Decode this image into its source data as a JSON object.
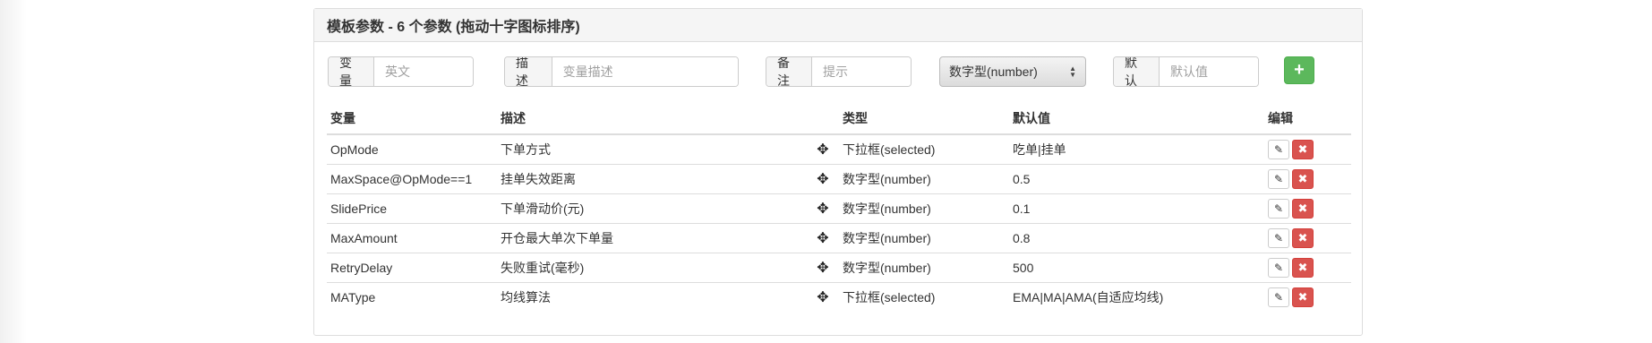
{
  "panel": {
    "title": "模板参数 - 6 个参数 (拖动十字图标排序)"
  },
  "form": {
    "variable": {
      "label": "变量",
      "placeholder": "英文"
    },
    "description": {
      "label": "描述",
      "placeholder": "变量描述"
    },
    "note": {
      "label": "备注",
      "placeholder": "提示"
    },
    "type_select": {
      "value": "数字型(number)"
    },
    "default": {
      "label": "默认",
      "placeholder": "默认值"
    },
    "add_icon": "plus-icon"
  },
  "table": {
    "headers": [
      "变量",
      "描述",
      "类型",
      "默认值",
      "编辑"
    ],
    "rows": [
      {
        "variable": "OpMode",
        "description": "下单方式",
        "type": "下拉框(selected)",
        "default": "吃单|挂单"
      },
      {
        "variable": "MaxSpace@OpMode==1",
        "description": "挂单失效距离",
        "type": "数字型(number)",
        "default": "0.5"
      },
      {
        "variable": "SlidePrice",
        "description": "下单滑动价(元)",
        "type": "数字型(number)",
        "default": "0.1"
      },
      {
        "variable": "MaxAmount",
        "description": "开仓最大单次下单量",
        "type": "数字型(number)",
        "default": "0.8"
      },
      {
        "variable": "RetryDelay",
        "description": "失败重试(毫秒)",
        "type": "数字型(number)",
        "default": "500"
      },
      {
        "variable": "MAType",
        "description": "均线算法",
        "type": "下拉框(selected)",
        "default": "EMA|MA|AMA(自适应均线)"
      }
    ]
  },
  "colors": {
    "add_button": "#5cb85c",
    "delete_button": "#d9534f"
  }
}
